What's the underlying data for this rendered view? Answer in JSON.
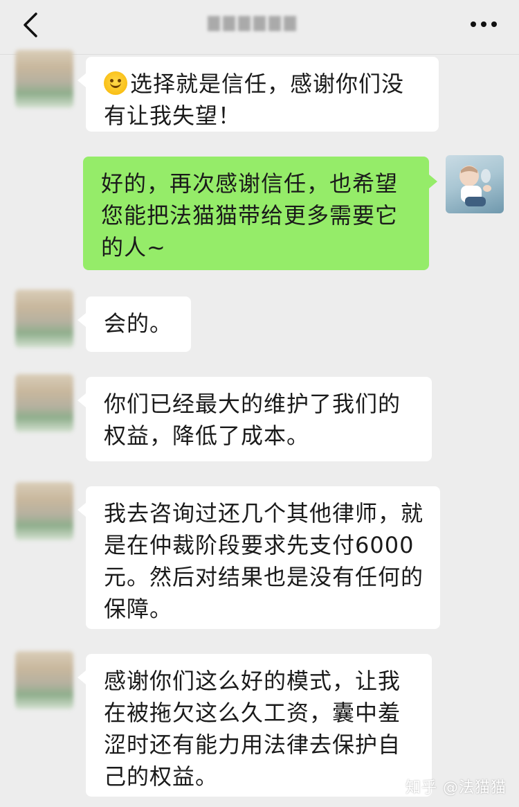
{
  "header": {
    "back_icon": "chevron-left-icon",
    "more_icon": "more-horizontal-icon"
  },
  "messages": [
    {
      "side": "left",
      "emoji": "smiley-emoji",
      "text": "选择就是信任，感谢你们没有让我失望！"
    },
    {
      "side": "right",
      "text": "好的，再次感谢信任，也希望您能把法猫猫带给更多需要它的人~"
    },
    {
      "side": "left",
      "text": "会的。"
    },
    {
      "side": "left",
      "text": "你们已经最大的维护了我们的权益，降低了成本。"
    },
    {
      "side": "left",
      "text": "我去咨询过还几个其他律师，就是在仲裁阶段要求先支付6000元。然后对结果也是没有任何的保障。"
    },
    {
      "side": "left",
      "text": "感谢你们这么好的模式，让我在被拖欠这么久工资，囊中羞涩时还有能力用法律去保护自己的权益。"
    }
  ],
  "watermark": "知乎 @法猫猫",
  "colors": {
    "background": "#ededed",
    "incoming_bubble": "#ffffff",
    "outgoing_bubble": "#95ec69",
    "text": "#1a1a1a"
  }
}
